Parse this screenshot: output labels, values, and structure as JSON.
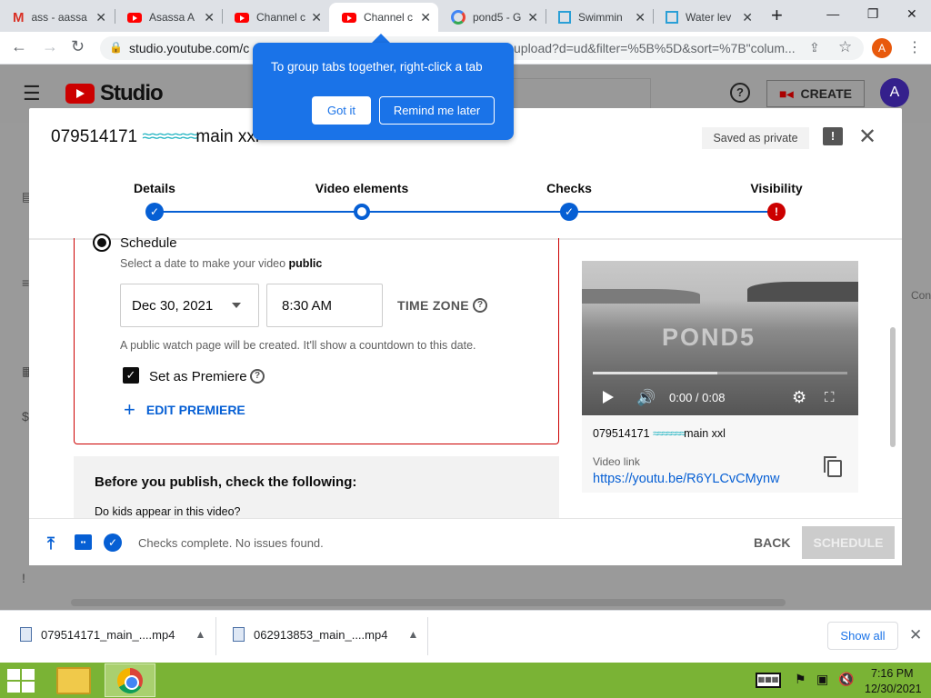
{
  "browser": {
    "tabs": [
      {
        "label": "ass - aassa",
        "favicon": "gmail-icon"
      },
      {
        "label": "Asassa A",
        "favicon": "youtube-icon"
      },
      {
        "label": "Channel c",
        "favicon": "youtube-icon"
      },
      {
        "label": "Channel c",
        "favicon": "youtube-icon",
        "active": true
      },
      {
        "label": "pond5 - G",
        "favicon": "google-icon"
      },
      {
        "label": "Swimmin",
        "favicon": "pond5-icon"
      },
      {
        "label": "Water lev",
        "favicon": "pond5-icon"
      }
    ],
    "new_tab": "+",
    "url_host": "studio.youtube.com/c",
    "url_tail": "upload?d=ud&filter=%5B%5D&sort=%7B\"colum...",
    "profile_initial": "A"
  },
  "tooltip": {
    "message": "To group tabs together, right-click a tab",
    "got_it": "Got it",
    "remind": "Remind me later"
  },
  "studio": {
    "logo_text": "Studio",
    "create_label": "CREATE",
    "avatar_initial": "A",
    "side_label": "Con"
  },
  "dialog": {
    "title_prefix": "079514171 ",
    "title_wave": "≈≈≈≈≈≈≈",
    "title_suffix": "main xxl",
    "saved_badge": "Saved as private",
    "steps": [
      {
        "label": "Details",
        "state": "done"
      },
      {
        "label": "Video elements",
        "state": "current"
      },
      {
        "label": "Checks",
        "state": "done"
      },
      {
        "label": "Visibility",
        "state": "error"
      }
    ],
    "schedule": {
      "option_label": "Schedule",
      "hint_prefix": "Select a date to make your video ",
      "hint_bold": "public",
      "date": "Dec 30, 2021",
      "time": "8:30 AM",
      "time_zone": "TIME ZONE",
      "watch_note": "A public watch page will be created. It'll show a countdown to this date.",
      "premiere_label": "Set as Premiere",
      "edit_premiere": "EDIT PREMIERE"
    },
    "before_publish": {
      "title": "Before you publish, check the following:",
      "question": "Do kids appear in this video?"
    },
    "video": {
      "watermark": "POND5",
      "time": "0:00 / 0:08",
      "progress": 0.49,
      "title_prefix": "079514171 ",
      "title_wave": "≈≈≈≈≈≈≈",
      "title_suffix": "main xxl",
      "link_label": "Video link",
      "link": "https://youtu.be/R6YLCvCMynw"
    },
    "footer": {
      "checks_message": "Checks complete. No issues found.",
      "back": "BACK",
      "schedule": "SCHEDULE"
    }
  },
  "downloads": {
    "items": [
      {
        "name": "079514171_main_....mp4"
      },
      {
        "name": "062913853_main_....mp4"
      }
    ],
    "show_all": "Show all"
  },
  "taskbar": {
    "time": "7:16 PM",
    "date": "12/30/2021"
  },
  "colors": {
    "accent": "#065fd4",
    "error": "#cc0000",
    "tooltip": "#1a73e8",
    "taskbar": "#7ab335"
  }
}
